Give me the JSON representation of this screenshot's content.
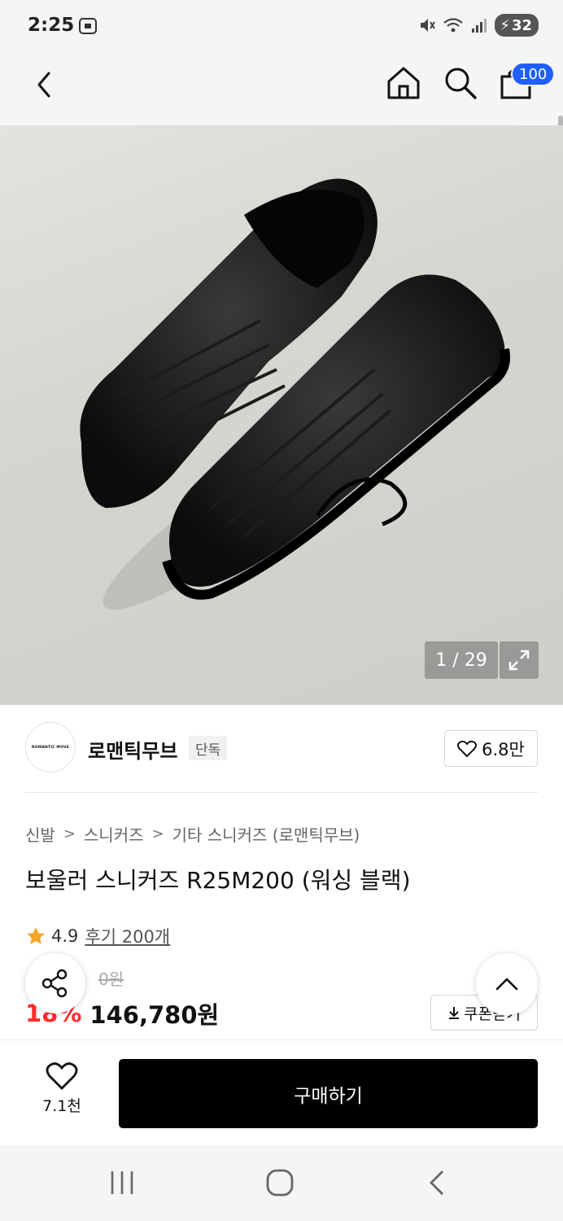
{
  "status_bar": {
    "time": "2:25",
    "battery": "32"
  },
  "header": {
    "cart_badge": "100"
  },
  "gallery": {
    "counter": "1 / 29"
  },
  "brand": {
    "logo_text": "ROMANTIC MOVE",
    "name": "로맨틱무브",
    "badge": "단독",
    "likes": "6.8만"
  },
  "breadcrumb": {
    "items": [
      "신발",
      "스니커즈",
      "기타 스니커즈 (로맨틱무브)"
    ],
    "separator": ">"
  },
  "product": {
    "title": "보울러 스니커즈 R25M200 (워싱 블랙)",
    "rating": "4.9",
    "reviews": "후기 200개",
    "original_price": "0원",
    "discount": "18%",
    "sale_price": "146,780원",
    "coupon_label": "쿠폰받기"
  },
  "bottom_bar": {
    "wish_count": "7.1천",
    "buy_label": "구매하기"
  },
  "colors": {
    "accent_blue": "#1f5fff",
    "discount_red": "#ff2d2d",
    "buy_bg": "#000000",
    "star": "#f5a623"
  }
}
